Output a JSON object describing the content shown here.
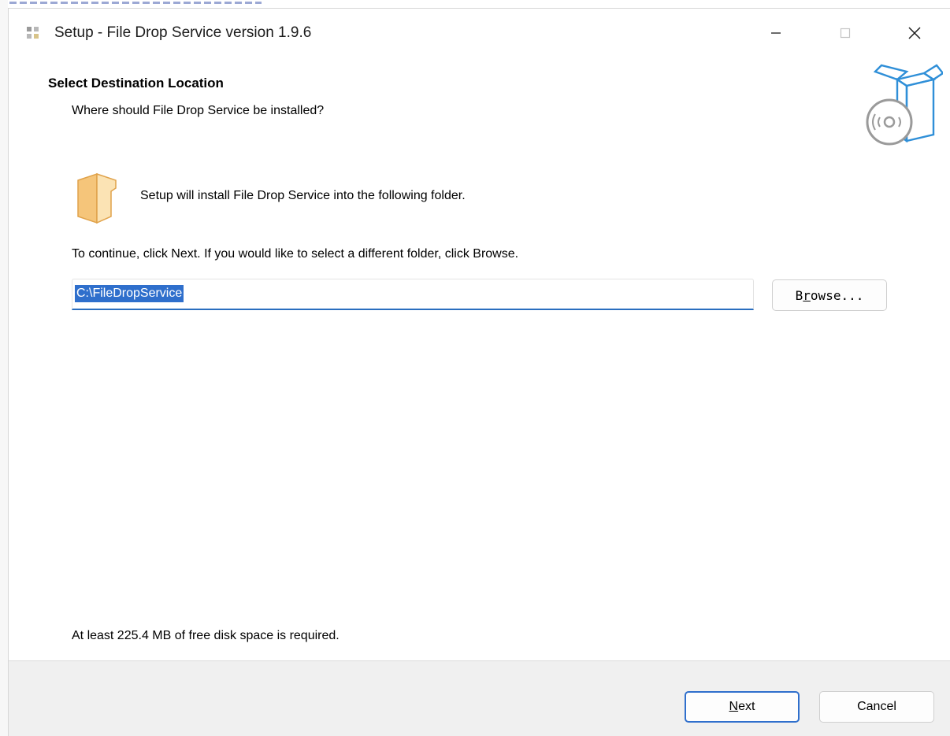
{
  "window": {
    "title": "Setup - File Drop Service version 1.9.6",
    "controls": [
      "minimize-icon",
      "maximize-icon",
      "close-icon"
    ]
  },
  "header": {
    "title": "Select Destination Location",
    "subtitle": "Where should File Drop Service be installed?"
  },
  "body": {
    "install_text": "Setup will install File Drop Service into the following folder.",
    "continue_text": "To continue, click Next. If you would like to select a different folder, click Browse.",
    "path_value": "C:\\FileDropService",
    "browse": {
      "before": "B",
      "accel": "r",
      "after": "owse..."
    },
    "disk_space_text": "At least 225.4 MB of free disk space is required."
  },
  "footer": {
    "next": {
      "accel": "N",
      "after": "ext"
    },
    "cancel_label": "Cancel"
  },
  "colors": {
    "accent": "#2f6fcc",
    "folder": "#f5c57a",
    "footer_bg": "#f0f0f0"
  }
}
